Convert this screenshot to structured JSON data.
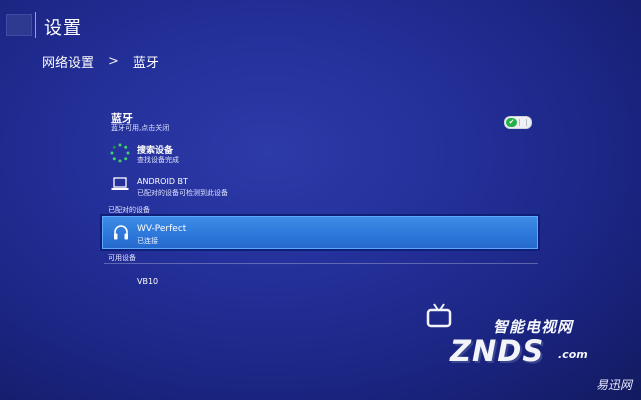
{
  "header": {
    "title": "设置"
  },
  "breadcrumb": {
    "parent": "网络设置",
    "separator": ">",
    "current": "蓝牙"
  },
  "bluetooth": {
    "title": "蓝牙",
    "subtitle": "蓝牙可用,点击关闭",
    "toggle_state": "on",
    "toggle_color": "#27b04a"
  },
  "scan": {
    "icon": "spinner-icon",
    "title": "搜索设备",
    "subtitle": "查找设备完成"
  },
  "this_device": {
    "icon": "laptop-icon",
    "title": "ANDROID BT",
    "subtitle": "已配对的设备可检测到此设备"
  },
  "paired_section": {
    "label": "已配对的设备",
    "devices": [
      {
        "icon": "headphones-icon",
        "name": "WV-Perfect",
        "status": "已连接",
        "selected": true
      }
    ]
  },
  "available_section": {
    "label": "可用设备",
    "devices": [
      {
        "name": "VB10"
      }
    ]
  },
  "watermark": {
    "site_cn": "智能电视网",
    "logo": "ZNDS",
    "domain": ".com",
    "corner_text": "易迅网"
  },
  "colors": {
    "background": "#24309a",
    "selection": "#2d78da",
    "accent_green": "#27b04a"
  }
}
